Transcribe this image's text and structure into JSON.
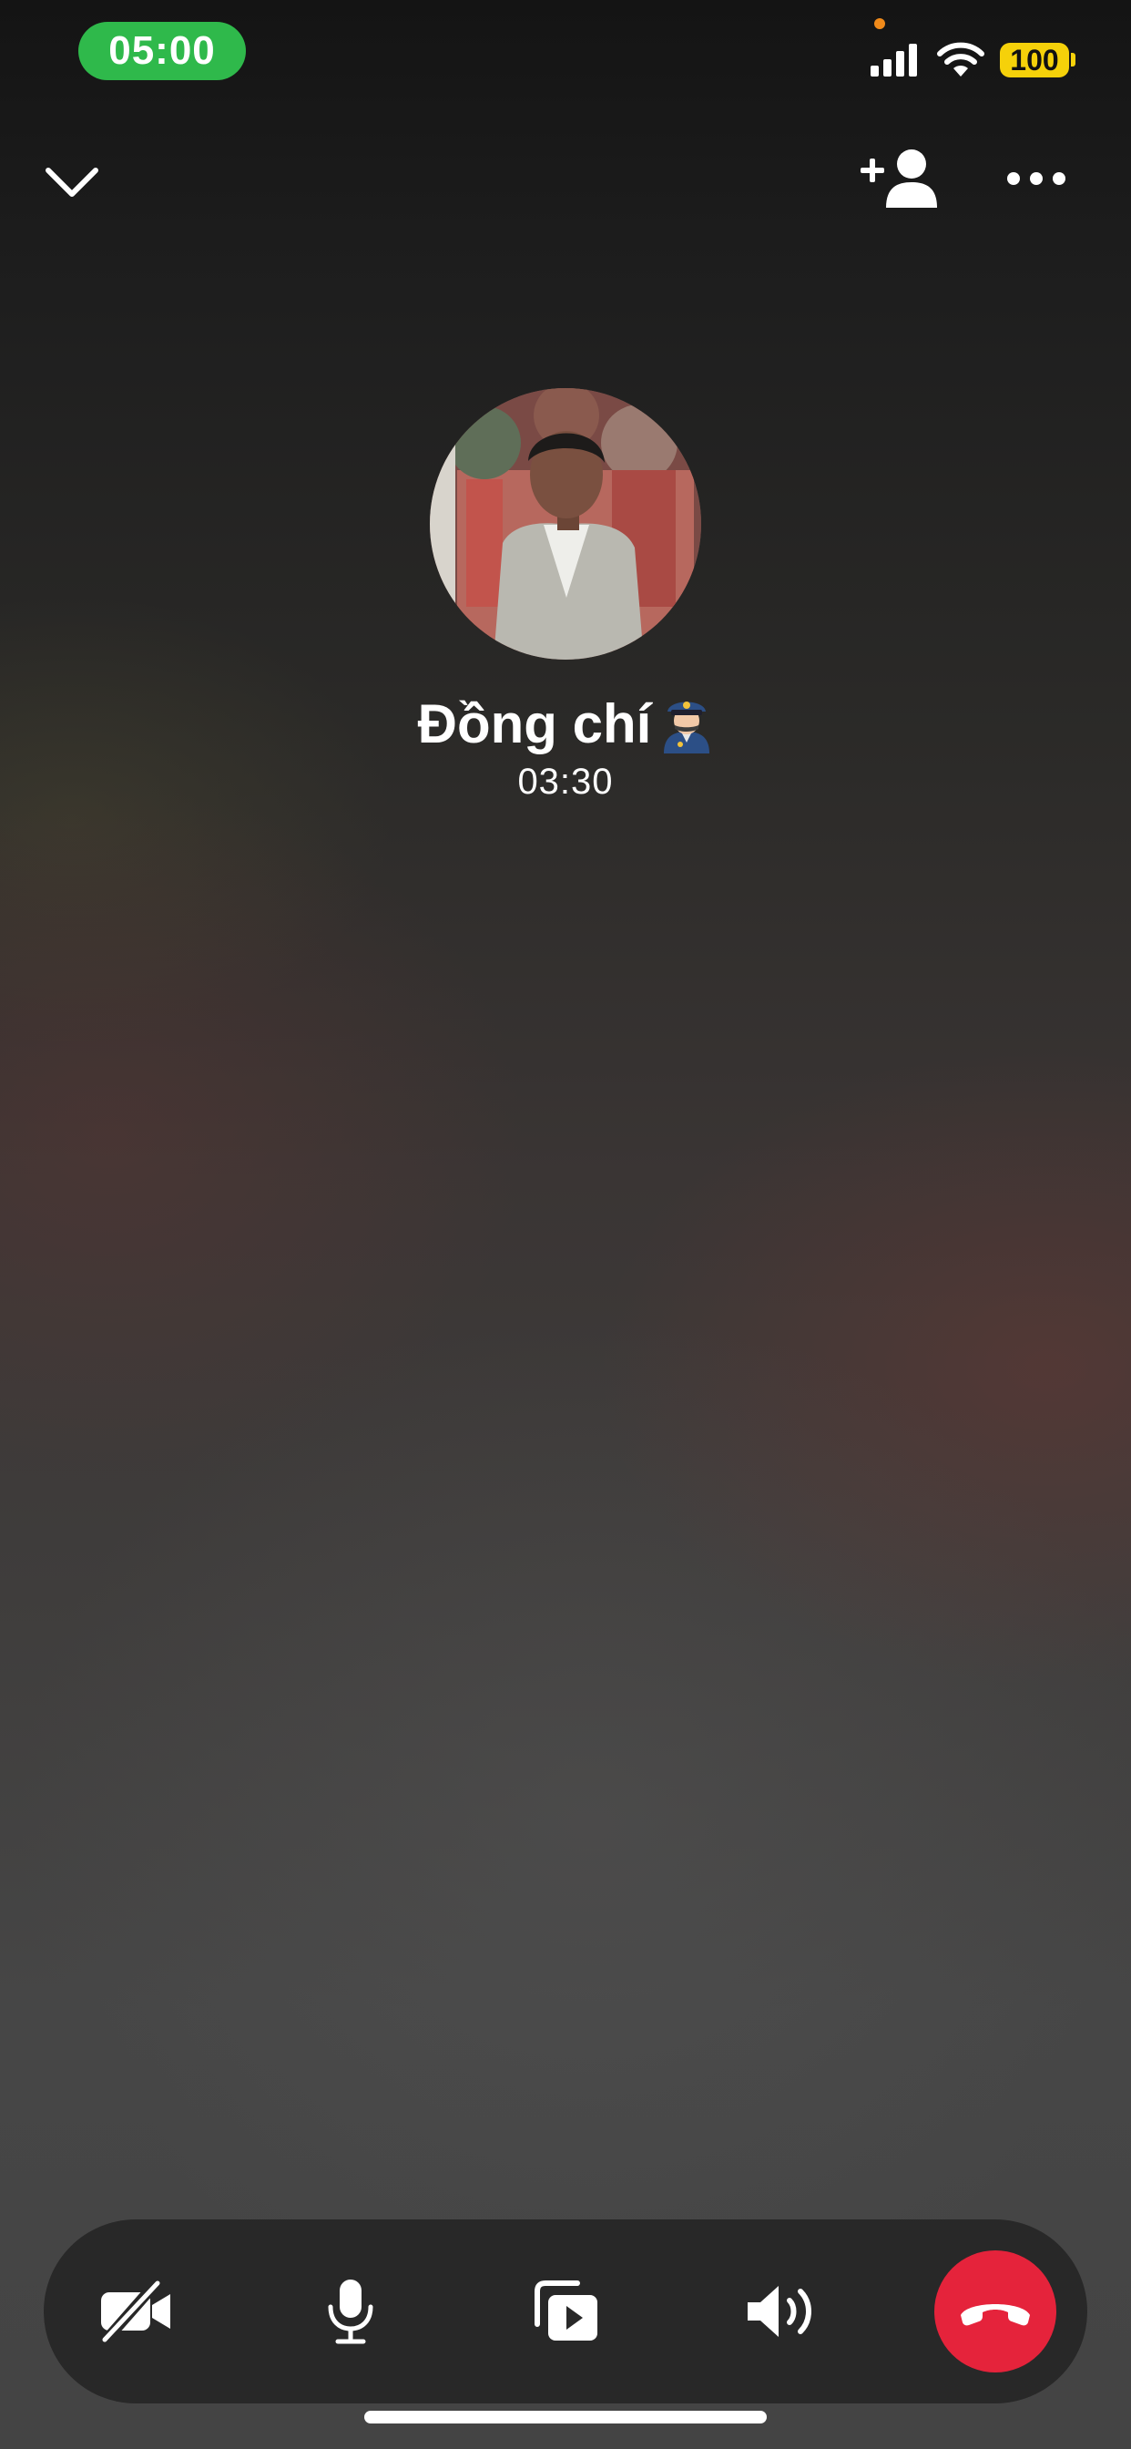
{
  "status_bar": {
    "time": "05:00",
    "battery_level": "100",
    "icons": [
      "cellular-signal-icon",
      "wifi-icon",
      "battery-icon"
    ]
  },
  "nav": {
    "collapse_icon": "chevron-down-icon",
    "add_participant_icon": "add-person-icon",
    "more_icon": "ellipsis-icon"
  },
  "caller": {
    "name": "Đồng chí",
    "name_emoji": "police-officer-emoji",
    "duration": "03:30",
    "avatar": "profile-photo"
  },
  "controls": [
    {
      "name": "video-off",
      "icon": "video-off-icon"
    },
    {
      "name": "microphone",
      "icon": "microphone-icon"
    },
    {
      "name": "share-media",
      "icon": "share-media-icon"
    },
    {
      "name": "speaker",
      "icon": "speaker-icon"
    },
    {
      "name": "end-call",
      "icon": "phone-hangup-icon"
    }
  ],
  "colors": {
    "time_pill": "#2fb94b",
    "battery": "#f5d10a",
    "end_call": "#e5233b",
    "control_bar": "#282828",
    "privacy_dot": "#f08a1a"
  }
}
